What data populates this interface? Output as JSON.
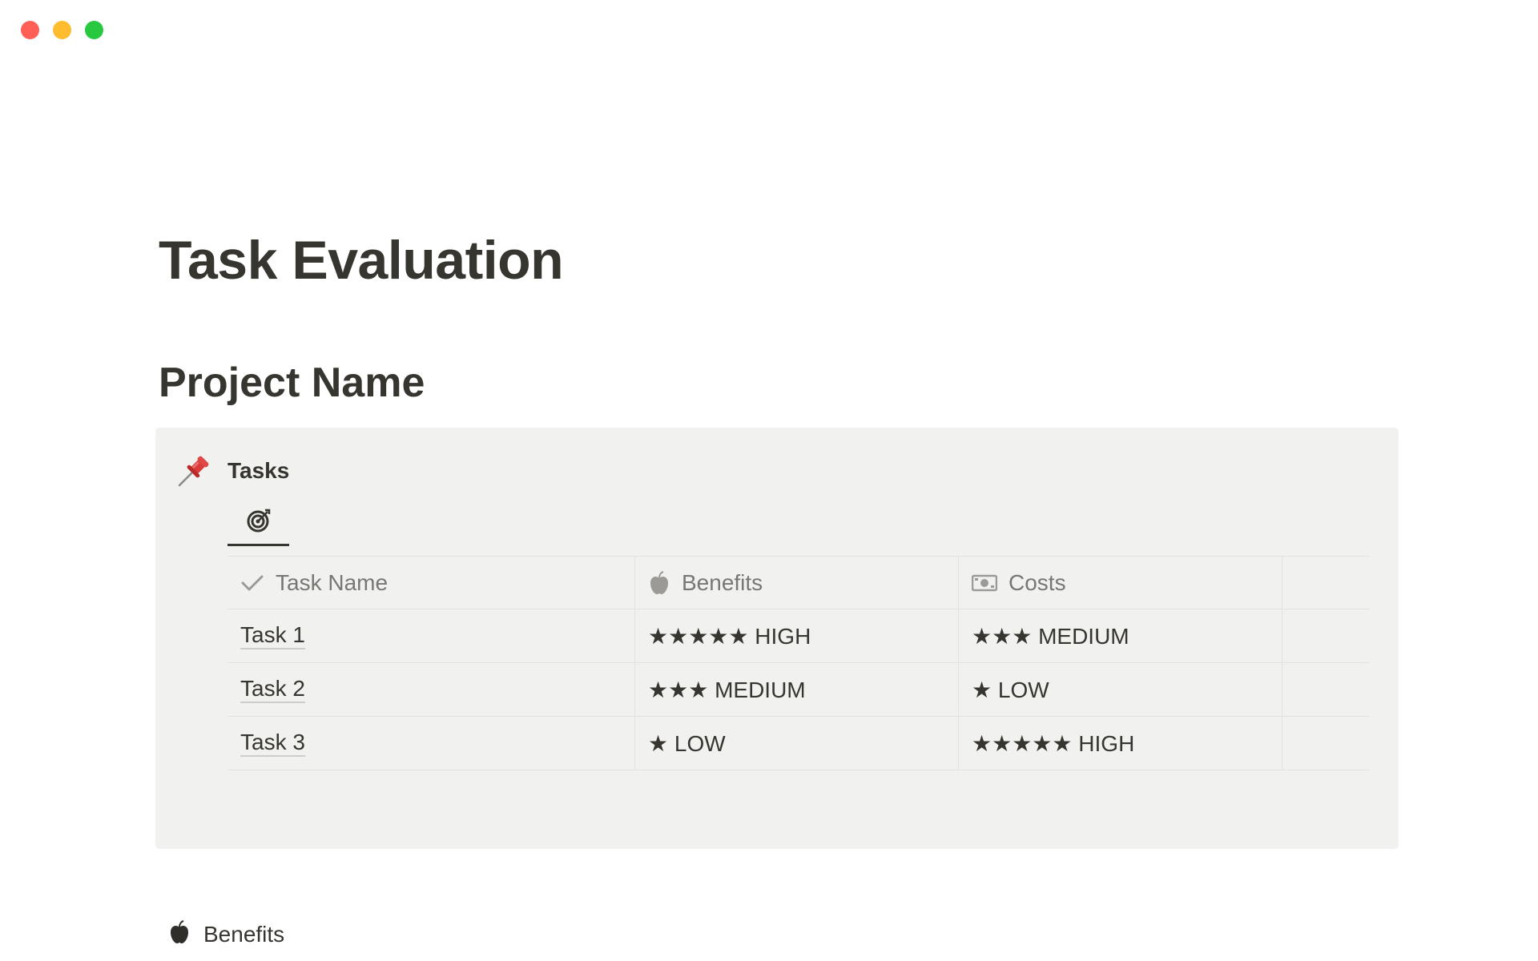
{
  "window": {
    "controls": [
      {
        "name": "close",
        "color": "#ff5f57"
      },
      {
        "name": "minimize",
        "color": "#febc2e"
      },
      {
        "name": "zoom",
        "color": "#28c840"
      }
    ]
  },
  "page": {
    "title": "Task Evaluation",
    "section_heading": "Project Name"
  },
  "callout": {
    "icon": "pushpin-icon",
    "label": "Tasks",
    "view_tab_icon": "target-icon"
  },
  "table": {
    "columns": [
      {
        "icon": "checkmark-icon",
        "label": "Task Name"
      },
      {
        "icon": "apple-icon",
        "label": "Benefits"
      },
      {
        "icon": "banknote-icon",
        "label": "Costs"
      }
    ],
    "rows": [
      {
        "name": "Task 1",
        "benefits": "★★★★★ HIGH",
        "costs": "★★★ MEDIUM"
      },
      {
        "name": "Task 2",
        "benefits": "★★★ MEDIUM",
        "costs": "★ LOW"
      },
      {
        "name": "Task 3",
        "benefits": "★ LOW",
        "costs": "★★★★★ HIGH"
      }
    ]
  },
  "bottom_section": {
    "icon": "apple-icon",
    "label": "Benefits"
  }
}
